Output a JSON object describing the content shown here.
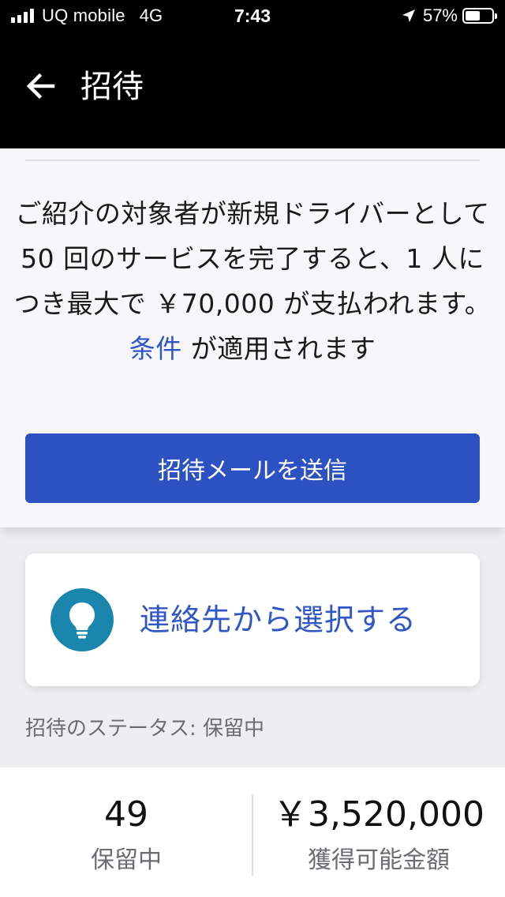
{
  "status_bar": {
    "carrier": "UQ mobile",
    "network": "4G",
    "time": "7:43",
    "battery_percent": "57%",
    "battery_level": 0.57,
    "signal_icon": "signal-bars-icon",
    "location_icon": "location-arrow-icon"
  },
  "header": {
    "title": "招待",
    "back_icon": "arrow-left-icon"
  },
  "invite_card": {
    "description_before": "ご紹介の対象者が新規ドライバーとして 50 回のサービスを完了すると、1 人につき最大で ￥70,000 が支払われます。",
    "terms_link": "条件",
    "description_after": " が適用されます",
    "send_button_label": "招待メールを送信"
  },
  "contacts": {
    "label": "連絡先から選択する",
    "icon": "lightbulb-icon"
  },
  "invite_status": "招待のステータス: 保留中",
  "stats": {
    "pending_count": "49",
    "pending_label": "保留中",
    "earnable_amount": "￥3,520,000",
    "earnable_label": "獲得可能金額"
  },
  "colors": {
    "accent_blue": "#2c51c2",
    "link_blue": "#2f55c6",
    "bulb_teal": "#1a86ad",
    "header_bg": "#000000"
  }
}
